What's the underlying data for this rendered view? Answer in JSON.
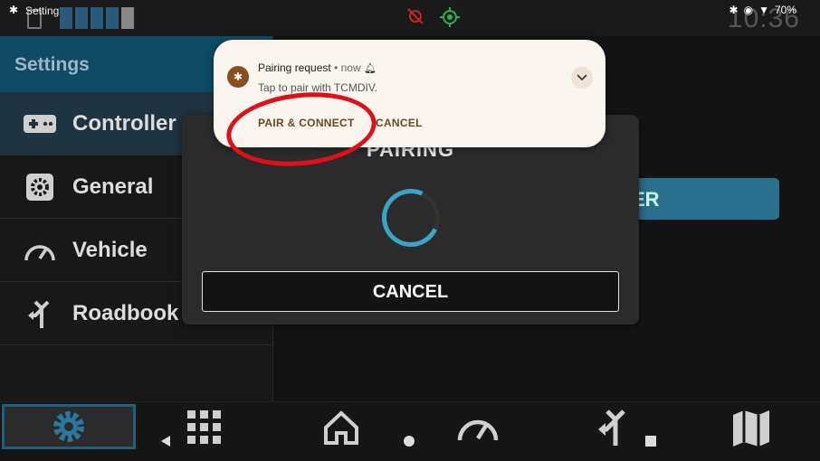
{
  "statusbar": {
    "app_title": "Settings",
    "battery": "70%",
    "time": "10:36",
    "bt_icon": "bluetooth-icon"
  },
  "sidebar": {
    "header": "Settings",
    "items": [
      {
        "label": "Controller",
        "icon": "gamepad-icon",
        "active": true
      },
      {
        "label": "General",
        "icon": "gear-icon"
      },
      {
        "label": "Vehicle",
        "icon": "speedometer-icon"
      },
      {
        "label": "Roadbook",
        "icon": "fork-arrow-icon"
      }
    ]
  },
  "content": {
    "partial_button": "ER"
  },
  "dialog": {
    "title": "PAIRING",
    "cancel": "CANCEL"
  },
  "notification": {
    "title": "Pairing request",
    "time": "• now",
    "body": "Tap to pair with TCMDIV.",
    "actions": [
      "PAIR & CONNECT",
      "CANCEL"
    ]
  },
  "colors": {
    "accent": "#2a6f8e",
    "header_bg": "#0f4a66",
    "highlight": "#e0101a",
    "notif_bg": "#fbf5ef"
  }
}
